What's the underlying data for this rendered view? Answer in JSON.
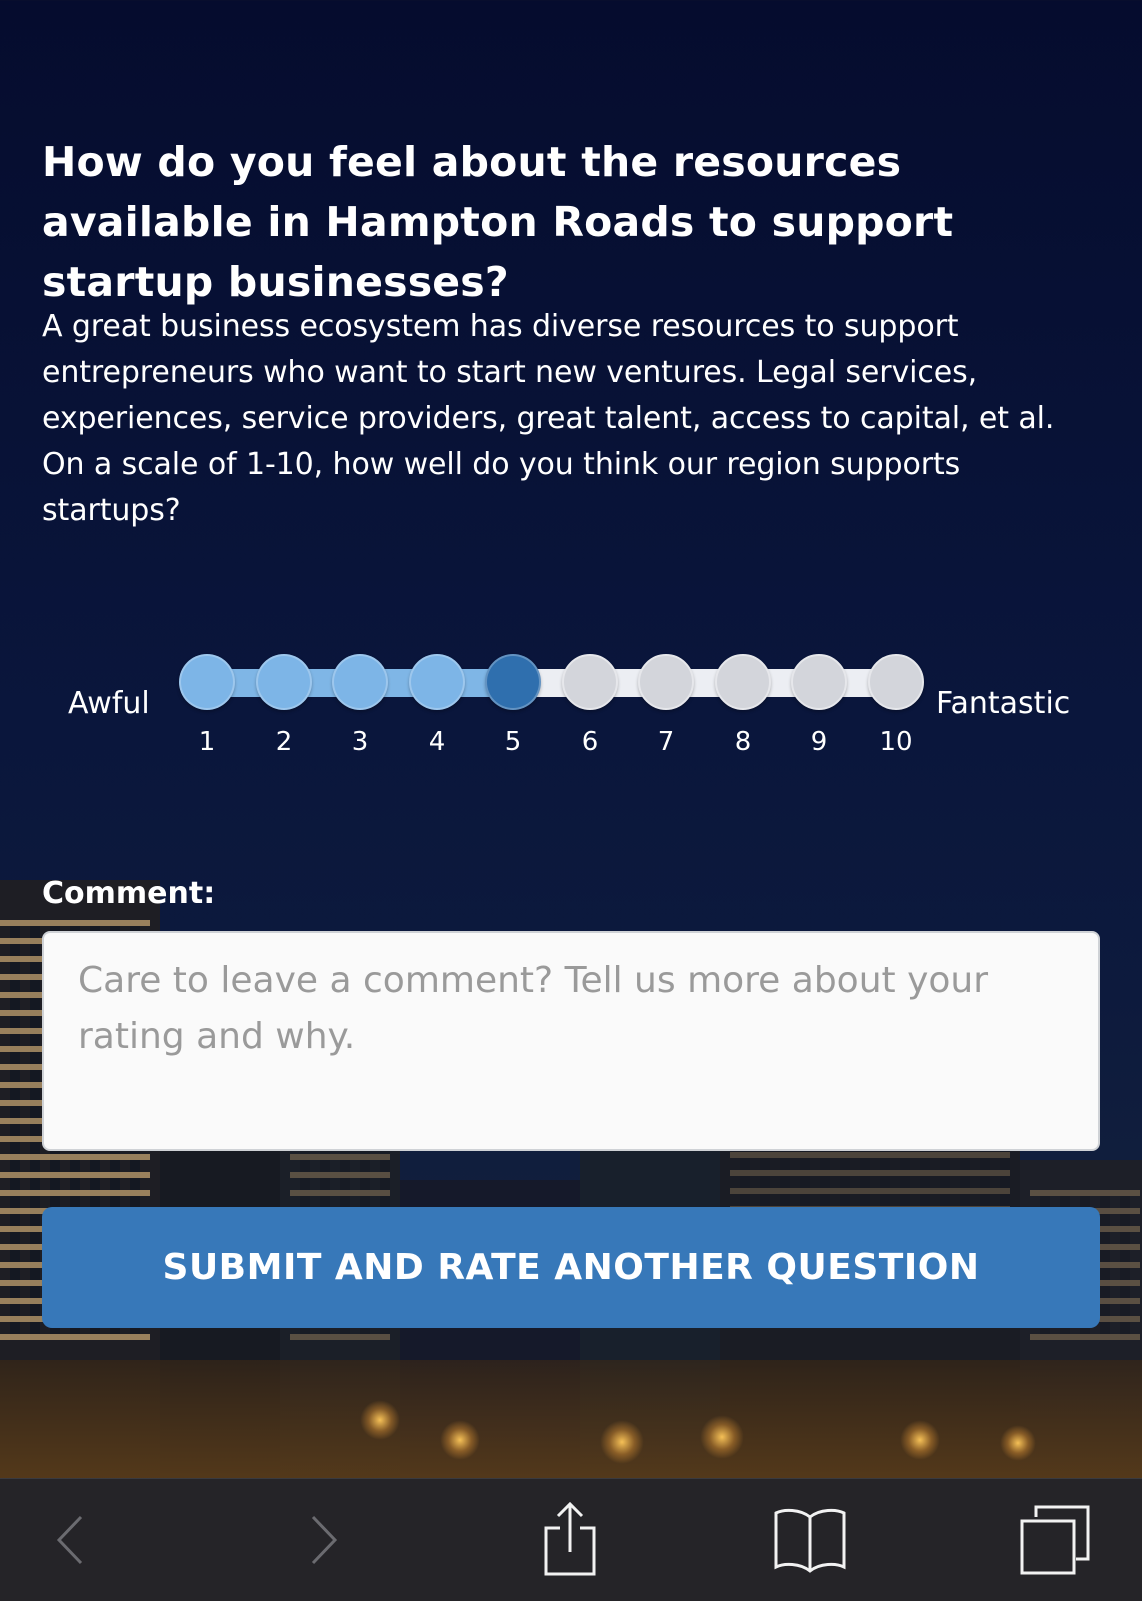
{
  "question": {
    "title": "How do you feel about the resources available in Hampton Roads to support startup businesses?",
    "description": "A great business ecosystem has diverse resources to support entrepreneurs who want to start new ventures. Legal services, experiences, service providers, great talent, access to capital, et al. On a scale of 1-10, how well do you think our region supports startups?"
  },
  "rating": {
    "low_label": "Awful",
    "high_label": "Fantastic",
    "selected": 5,
    "options": [
      "1",
      "2",
      "3",
      "4",
      "5",
      "6",
      "7",
      "8",
      "9",
      "10"
    ],
    "colors": {
      "filled": "#7db5e7",
      "selected": "#2f6fae",
      "empty": "#d3d5db"
    }
  },
  "comment": {
    "label": "Comment:",
    "value": "",
    "placeholder": "Care to leave a comment? Tell us more about your rating and why."
  },
  "submit": {
    "label": "SUBMIT AND RATE ANOTHER QUESTION",
    "color": "#3778b9"
  },
  "toolbar": {
    "icons": [
      "back-icon",
      "forward-icon",
      "share-icon",
      "bookmarks-icon",
      "tabs-icon"
    ]
  }
}
